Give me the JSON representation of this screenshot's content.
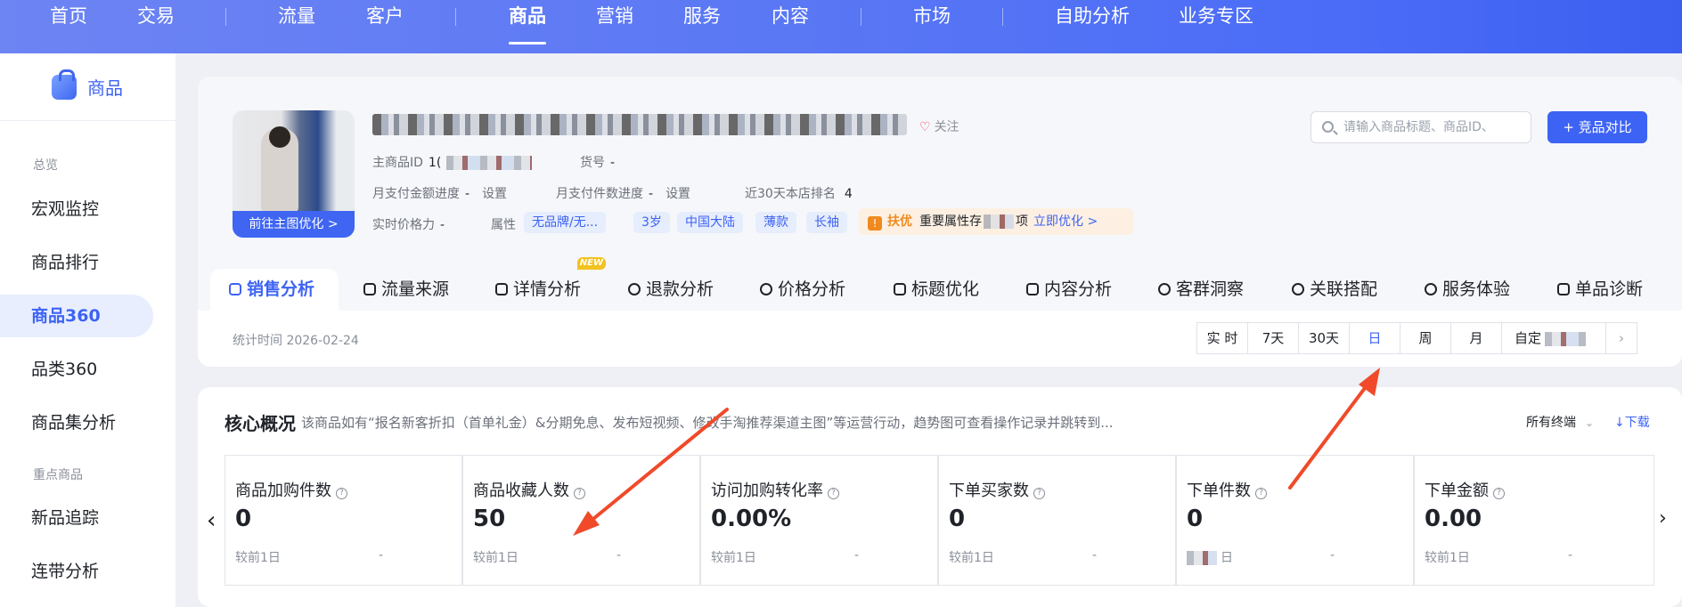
{
  "topnav": {
    "items": [
      "首页",
      "交易",
      "流量",
      "客户",
      "商品",
      "营销",
      "服务",
      "内容",
      "市场",
      "自助分析",
      "业务专区"
    ],
    "active": "商品"
  },
  "sidebar": {
    "title": "商品",
    "group1": "总览",
    "items1": [
      "宏观监控",
      "商品排行",
      "商品360",
      "品类360",
      "商品集分析"
    ],
    "group2": "重点商品",
    "items2": [
      "新品追踪",
      "连带分析"
    ],
    "active": "商品360"
  },
  "product": {
    "image_button": "前往主图优化 >",
    "follow": "关注",
    "main_id_label": "主商品ID",
    "main_id_value": "1(",
    "sku_label": "货号",
    "sku_value": "-",
    "pay_amount_label": "月支付金额进度",
    "pay_amount_value": "-",
    "pay_amount_link": "设置",
    "pay_count_label": "月支付件数进度",
    "pay_count_value": "-",
    "pay_count_link": "设置",
    "rank_label": "近30天本店排名",
    "rank_value": "4",
    "price_label": "实时价格力",
    "price_value": "-",
    "attr_label": "属性",
    "tags": [
      "无品牌/无...",
      "3岁",
      "中国大陆",
      "薄款",
      "长袖"
    ],
    "boost_key": "扶优",
    "boost_text": "重要属性存",
    "boost_text2": "项",
    "boost_link": "立即优化 >"
  },
  "search": {
    "placeholder": "请输入商品标题、商品ID、"
  },
  "compare_button": "+ 竞品对比",
  "tabs": [
    "销售分析",
    "流量来源",
    "详情分析",
    "退款分析",
    "价格分析",
    "标题优化",
    "内容分析",
    "客群洞察",
    "关联搭配",
    "服务体验",
    "单品诊断"
  ],
  "tab_new_badge": "NEW",
  "stat": {
    "time": "统计时间 2026-02-24",
    "periods": [
      "实 时",
      "7天",
      "30天",
      "日",
      "周",
      "月",
      "自定"
    ],
    "selected": "日",
    "next": "›"
  },
  "core": {
    "title": "核心概况",
    "desc": "该商品如有“报名新客折扣（首单礼金）&分期免息、发布短视频、修改手淘推荐渠道主图”等运营行动，趋势图可查看操作记录并跳转到...",
    "channel": "所有终端",
    "download": "下载",
    "metrics": [
      {
        "label": "商品加购件数",
        "value": "0",
        "compare": "较前1日",
        "delta": "-"
      },
      {
        "label": "商品收藏人数",
        "value": "50",
        "compare": "较前1日",
        "delta": "-"
      },
      {
        "label": "访问加购转化率",
        "value": "0.00%",
        "compare": "较前1日",
        "delta": "-"
      },
      {
        "label": "下单买家数",
        "value": "0",
        "compare": "较前1日",
        "delta": "-"
      },
      {
        "label": "下单件数",
        "value": "0",
        "compare": "日",
        "delta": "-"
      },
      {
        "label": "下单金额",
        "value": "0.00",
        "compare": "较前1日",
        "delta": "-"
      }
    ]
  },
  "colors": {
    "primary": "#3d63f4",
    "nav": "#5b78f4",
    "arrow": "#f04a2a",
    "warn": "#f08a1f"
  }
}
